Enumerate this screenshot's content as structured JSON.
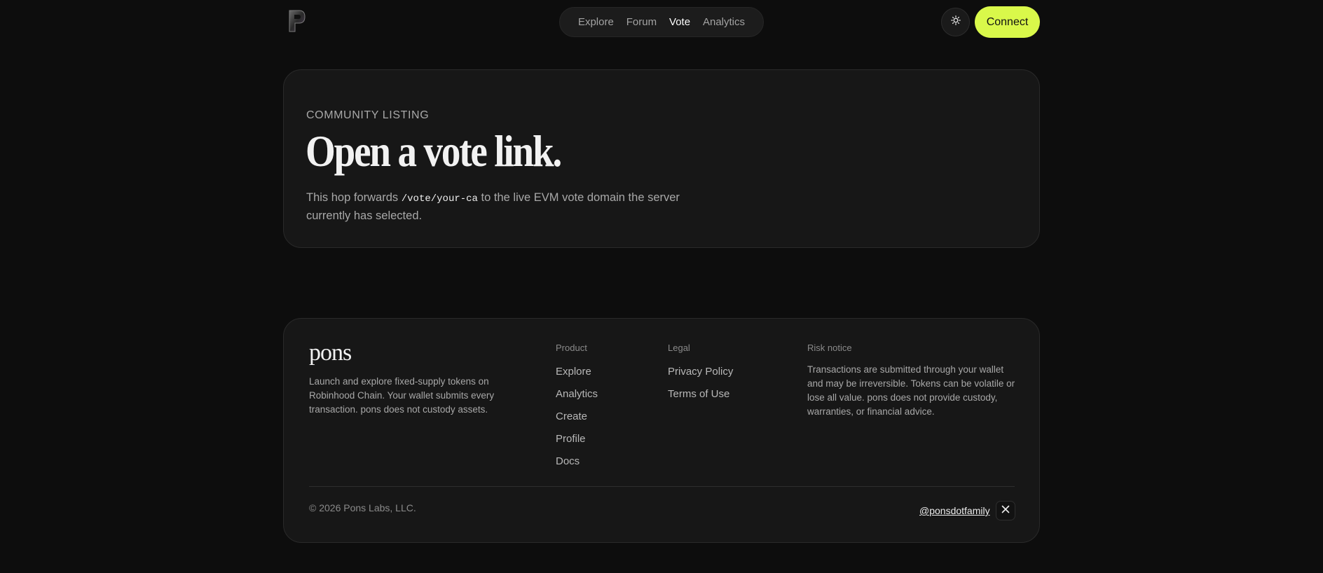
{
  "header": {
    "logo_icon": "pons-p-logo-icon",
    "nav": [
      {
        "label": "Explore",
        "active": false
      },
      {
        "label": "Forum",
        "active": false
      },
      {
        "label": "Vote",
        "active": true
      },
      {
        "label": "Analytics",
        "active": false
      }
    ],
    "theme_icon": "sun-icon",
    "connect_label": "Connect"
  },
  "hero": {
    "eyebrow": "COMMUNITY LISTING",
    "title": "Open a vote link.",
    "desc_before": "This hop forwards ",
    "desc_code": "/vote/your-ca",
    "desc_after": " to the live EVM vote domain the server currently has selected."
  },
  "footer": {
    "brand": "pons",
    "brand_desc": "Launch and explore fixed-supply tokens on Robinhood Chain. Your wallet submits every transaction. pons does not custody assets.",
    "product": {
      "heading": "Product",
      "links": [
        "Explore",
        "Analytics",
        "Create",
        "Profile",
        "Docs"
      ]
    },
    "legal": {
      "heading": "Legal",
      "links": [
        "Privacy Policy",
        "Terms of Use"
      ]
    },
    "risk": {
      "heading": "Risk notice",
      "text": "Transactions are submitted through your wallet and may be irreversible. Tokens can be volatile or lose all value. pons does not provide custody, warranties, or financial advice."
    },
    "copyright": "© 2026 Pons Labs, LLC.",
    "handle": "@ponsdotfamily",
    "social_icon": "x-icon"
  },
  "colors": {
    "background": "#0d0d0d",
    "card": "#171717",
    "accent": "#d9f84a"
  }
}
